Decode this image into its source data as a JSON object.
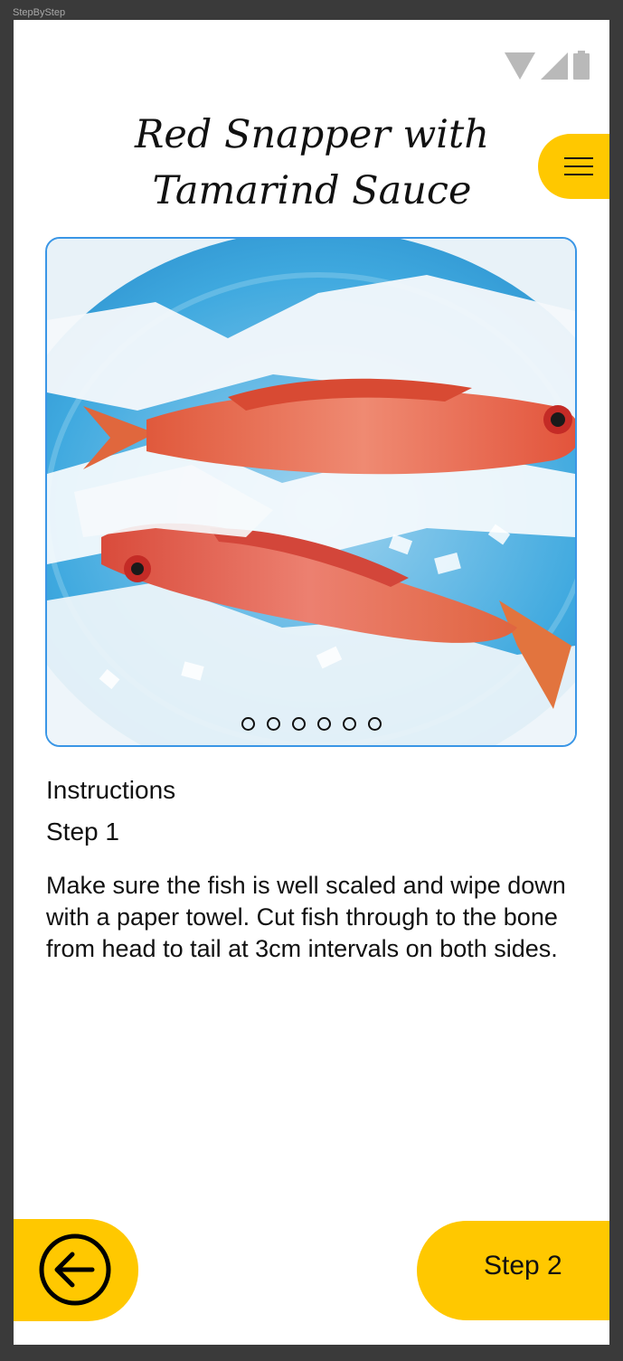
{
  "canvas": {
    "frame_label": "StepByStep"
  },
  "status_bar": {
    "icons": [
      "wifi-icon",
      "cellular-signal-icon",
      "battery-icon"
    ]
  },
  "recipe": {
    "title": "Red Snapper with Tamarind Sauce"
  },
  "menu": {
    "icon": "hamburger-menu-icon"
  },
  "gallery": {
    "image_alt": "Two red snapper fish on ice and paper",
    "dot_count": 6
  },
  "instructions": {
    "heading": "Instructions",
    "step_label": "Step 1",
    "text": "Make sure the fish is well scaled and wipe down with a paper towel. Cut fish through to the bone from head to tail at 3cm intervals on both sides."
  },
  "navigation": {
    "back_icon": "arrow-left-circle-icon",
    "next_label": "Step 2"
  },
  "colors": {
    "accent": "#ffc800",
    "image_border": "#3a96e6",
    "background": "#ffffff",
    "frame": "#3a3a3a",
    "text": "#111111"
  }
}
